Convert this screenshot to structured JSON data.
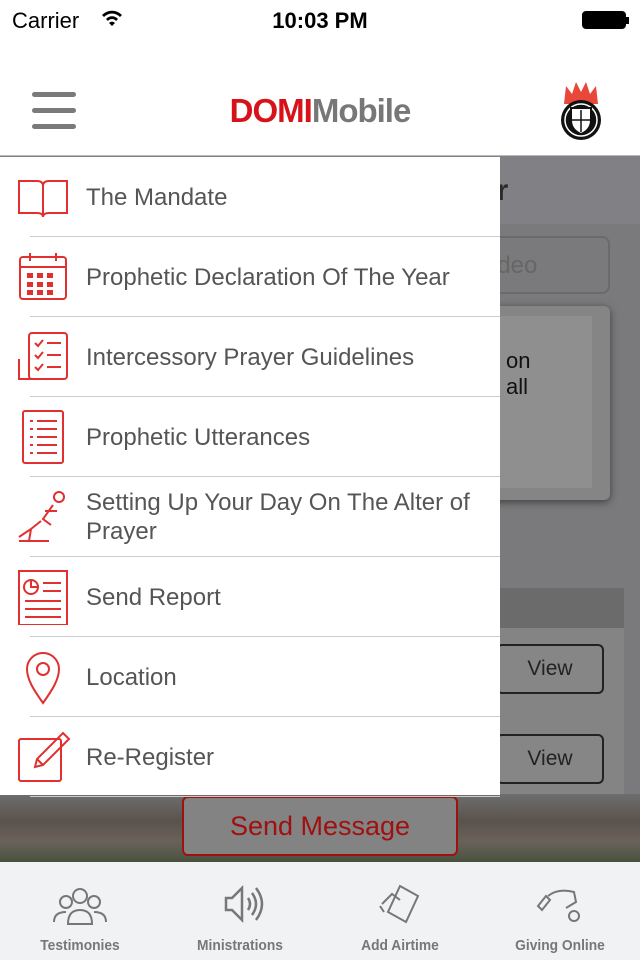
{
  "status_bar": {
    "carrier": "Carrier",
    "time": "10:03 PM"
  },
  "header": {
    "logo_red": "DOMI",
    "logo_gray": "Mobile"
  },
  "background": {
    "title_fragment": "er",
    "video_fragment": "ideo",
    "card_line1": "on",
    "card_line2": "all",
    "view_label": "View",
    "send_message": "Send Message"
  },
  "drawer": {
    "items": [
      {
        "label": "The Mandate",
        "icon": "book-icon"
      },
      {
        "label": " Prophetic Declaration Of The Year",
        "icon": "calendar-icon"
      },
      {
        "label": "Intercessory Prayer Guidelines",
        "icon": "checklist-icon"
      },
      {
        "label": "Prophetic Utterances",
        "icon": "list-document-icon"
      },
      {
        "label": "Setting Up Your Day On The Alter of Prayer",
        "icon": "kneeling-prayer-icon"
      },
      {
        "label": "Send Report",
        "icon": "report-icon"
      },
      {
        "label": "Location",
        "icon": "location-pin-icon"
      },
      {
        "label": "Re-Register",
        "icon": "edit-icon"
      }
    ]
  },
  "tabbar": {
    "items": [
      {
        "label": "Testimonies",
        "icon": "people-icon"
      },
      {
        "label": "Ministrations",
        "icon": "speaker-icon"
      },
      {
        "label": "Add Airtime",
        "icon": "phone-card-icon"
      },
      {
        "label": "Giving Online",
        "icon": "giving-hand-icon"
      }
    ]
  },
  "colors": {
    "accent": "#d8121a",
    "icon_gray": "#777777"
  }
}
